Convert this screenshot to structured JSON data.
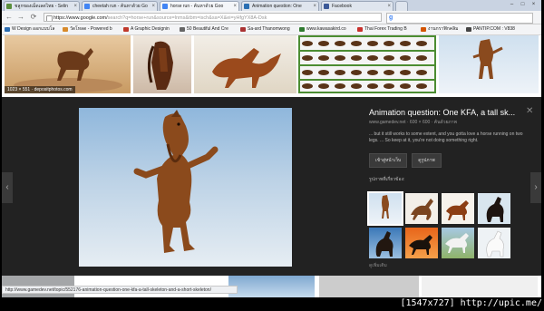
{
  "tabs": [
    {
      "label": "ชลูกของเม็ดเลดไทย - Selin",
      "active": false,
      "fav": "#5a8f3c"
    },
    {
      "label": "cheetah run - ค้นหาด้วย Go",
      "active": false,
      "fav": "#4285f4"
    },
    {
      "label": "horse run - ค้นหาด้วย Goo",
      "active": true,
      "fav": "#4285f4"
    },
    {
      "label": "Animation question: One",
      "active": false,
      "fav": "#2a6fb3"
    },
    {
      "label": "Facebook",
      "active": false,
      "fav": "#3b5998"
    }
  ],
  "url": {
    "host": "https://www.google.com/",
    "rest": "search?q=horse+run&source=lnms&tbm=isch&sa=X&ei=yHfgYX8A-Dsk"
  },
  "bookmarks": [
    {
      "label": "W Design ออกแบบโล",
      "color": "#2b6cb0"
    },
    {
      "label": "วัดโหลด - Powered b",
      "color": "#d88a2b"
    },
    {
      "label": "A Graphic Designin",
      "color": "#c0392b"
    },
    {
      "label": "50 Beautiful And Cre",
      "color": "#666666"
    },
    {
      "label": "Sa-ard Thanomwong",
      "color": "#a33"
    },
    {
      "label": "www.kawasakird.co",
      "color": "#2f7a2f"
    },
    {
      "label": "Thai Forex Trading B",
      "color": "#c9302c"
    },
    {
      "label": "งานกราฟิกคลิม",
      "color": "#d35400"
    },
    {
      "label": "PANTIP.COM : V838",
      "color": "#444"
    }
  ],
  "thumb_caption": "1023 × 551 · depositphotos.com",
  "preview": {
    "title": "Animation question: One KFA, a tall sk...",
    "source": "www.gamedev.net · 600 × 600 · ค้นด้วยภาพ",
    "description": "... but it still works to some extent, and you gotta love a horse running on two legs. ... So keep at it, you're not doing something right.",
    "visit_label": "เข้าสู่หน้าเว็บ",
    "view_label": "ดูรูปภาพ",
    "related_label": "รูปภาพที่เกี่ยวข้อง:",
    "more_label": "ดูเพิ่มเติม",
    "prev_icon": "chevron-left-icon",
    "next_icon": "chevron-right-icon"
  },
  "status_text": "http://www.gamedev.net/topic/552176-animation-question-one-kfa-a-tall-skeleton-and-a-short-skeleton/",
  "watermark": "[1547x727] http://upic.me/"
}
